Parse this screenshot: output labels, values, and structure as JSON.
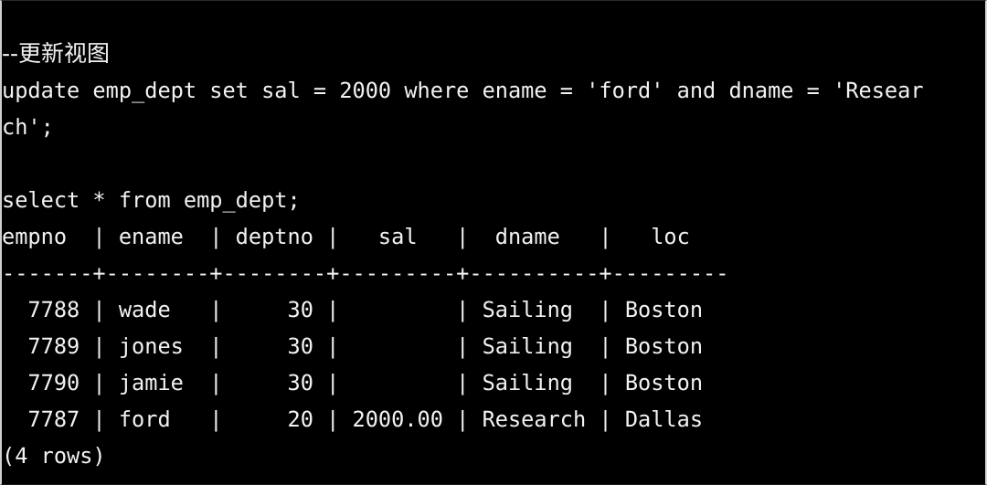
{
  "terminal": {
    "background_color": "#000000",
    "foreground_color": "#f2f2f2",
    "border_color": "#cfcfcf",
    "lines": {
      "comment": "--更新视图",
      "update_stmt_part1": "update emp_dept set sal = 2000 where ename = 'ford' and dname = 'Resear",
      "update_stmt_part2": "ch';",
      "blank": "",
      "select_stmt": "select * from emp_dept;",
      "table_header": "empno  | ename  | deptno |   sal   |  dname   |   loc",
      "table_separator": "-------+--------+--------+---------+----------+---------",
      "row_1": "  7788 | wade   |     30 |         | Sailing  | Boston",
      "row_2": "  7789 | jones  |     30 |         | Sailing  | Boston",
      "row_3": "  7790 | jamie  |     30 |         | Sailing  | Boston",
      "row_4": "  7787 | ford   |     20 | 2000.00 | Research | Dallas",
      "row_count": "(4 rows)"
    },
    "query_result": {
      "columns": [
        "empno",
        "ename",
        "deptno",
        "sal",
        "dname",
        "loc"
      ],
      "rows": [
        [
          "7788",
          "wade",
          "30",
          "",
          "Sailing",
          "Boston"
        ],
        [
          "7789",
          "jones",
          "30",
          "",
          "Sailing",
          "Boston"
        ],
        [
          "7790",
          "jamie",
          "30",
          "",
          "Sailing",
          "Boston"
        ],
        [
          "7787",
          "ford",
          "20",
          "2000.00",
          "Research",
          "Dallas"
        ]
      ],
      "row_count_label": "(4 rows)",
      "row_count": 4
    },
    "statements": {
      "comment_text": "--更新视图",
      "update": "update emp_dept set sal = 2000 where ename = 'ford' and dname = 'Research';",
      "select": "select * from emp_dept;",
      "view_name": "emp_dept",
      "set_column": "sal",
      "set_value": "2000",
      "where_ename": "ford",
      "where_dname": "Research"
    }
  }
}
